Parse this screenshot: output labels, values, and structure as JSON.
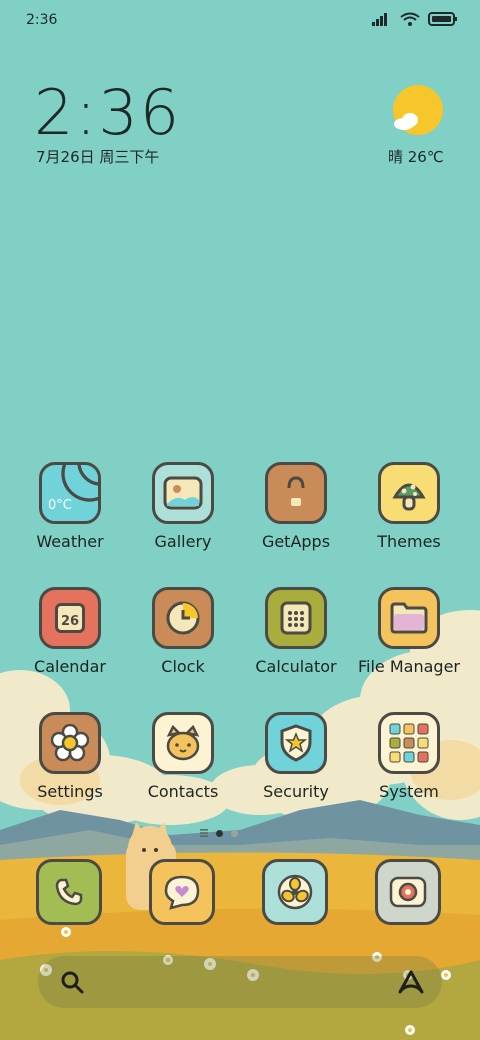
{
  "status_bar": {
    "time": "2:36",
    "signal_icon": "signal-icon",
    "wifi_icon": "wifi-icon",
    "battery_icon": "battery-icon"
  },
  "clock_widget": {
    "time": "2:36",
    "date": "7月26日 周三下午"
  },
  "weather_widget": {
    "condition_temp": "晴 26℃",
    "icon": "sun-cloud-icon"
  },
  "apps": [
    {
      "label": "Weather",
      "icon": "weather-icon",
      "color": "#6fd3d9",
      "badge": "0°C"
    },
    {
      "label": "Gallery",
      "icon": "gallery-icon",
      "color": "#aee0da"
    },
    {
      "label": "GetApps",
      "icon": "getapps-bag-icon",
      "color": "#c98b58"
    },
    {
      "label": "Themes",
      "icon": "themes-mushroom-icon",
      "color": "#f7dd73"
    },
    {
      "label": "Calendar",
      "icon": "calendar-icon",
      "color": "#e5725c",
      "badge": "26"
    },
    {
      "label": "Clock",
      "icon": "clock-icon",
      "color": "#c98b58"
    },
    {
      "label": "Calculator",
      "icon": "calculator-icon",
      "color": "#a8ad3b"
    },
    {
      "label": "File Manager",
      "icon": "folder-icon",
      "color": "#f5c35c"
    },
    {
      "label": "Settings",
      "icon": "settings-flower-icon",
      "color": "#c98b58"
    },
    {
      "label": "Contacts",
      "icon": "contacts-cat-icon",
      "color": "#fbf3d2"
    },
    {
      "label": "Security",
      "icon": "security-shield-icon",
      "color": "#6fd3d9"
    },
    {
      "label": "System",
      "icon": "system-folder-icon",
      "color": "#fbf3d2"
    }
  ],
  "page_indicator": {
    "current": 2,
    "total": 3
  },
  "dock": [
    {
      "name": "phone",
      "icon": "phone-icon",
      "color": "#a3bd55"
    },
    {
      "name": "messages",
      "icon": "message-heart-icon",
      "color": "#f5c35c"
    },
    {
      "name": "browser",
      "icon": "browser-fan-icon",
      "color": "#aee0da"
    },
    {
      "name": "camera",
      "icon": "camera-icon",
      "color": "#cfd6cc"
    }
  ],
  "search_bar": {
    "search_icon": "search-icon",
    "assistant_icon": "assistant-icon"
  }
}
